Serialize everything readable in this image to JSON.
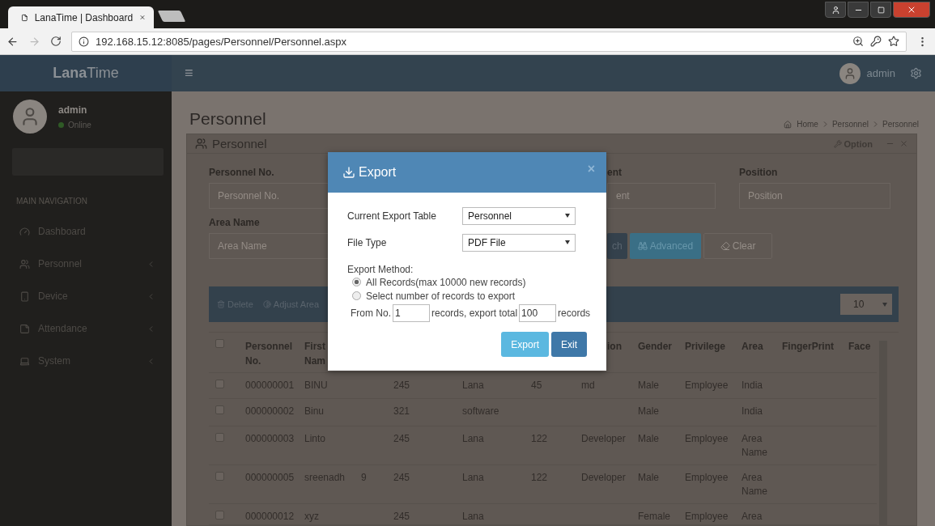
{
  "browser": {
    "tab_title": "LanaTime | Dashboard",
    "url": "192.168.15.12:8085/pages/Personnel/Personnel.aspx"
  },
  "app_header": {
    "logo": "**Lana**Time",
    "menu_icon": "≡",
    "user": "admin"
  },
  "sidebar": {
    "user": {
      "name": "admin",
      "status": "Online"
    },
    "nav_heading": "MAIN NAVIGATION",
    "items": [
      {
        "label": "Dashboard",
        "expandable": false
      },
      {
        "label": "Personnel",
        "expandable": true
      },
      {
        "label": "Device",
        "expandable": true
      },
      {
        "label": "Attendance",
        "expandable": true
      },
      {
        "label": "System",
        "expandable": true
      }
    ]
  },
  "page": {
    "title": "Personnel",
    "breadcrumb": [
      "Home",
      "Personnel",
      "Personnel"
    ]
  },
  "panel": {
    "title": "Personnel",
    "option": "Option"
  },
  "filters": [
    {
      "label": "Personnel No.",
      "placeholder": "Personnel No."
    },
    {
      "label": "ent",
      "placeholder": "ent"
    },
    {
      "label": "Position",
      "placeholder": "Position"
    },
    {
      "label": "Area Name",
      "placeholder": "Area Name"
    }
  ],
  "search_buttons": [
    {
      "label": "ch",
      "kind": "primary"
    },
    {
      "label": "Advanced",
      "kind": "info"
    },
    {
      "label": "Clear",
      "kind": "plain"
    }
  ],
  "toolbar": {
    "actions": [
      "Delete",
      "Adjust Area"
    ],
    "page_size": "10"
  },
  "table": {
    "header_checked": false,
    "columns": [
      "Personnel No.",
      "First Nam",
      null,
      null,
      null,
      null,
      "ion",
      "Gender",
      "Privilege",
      "Area",
      "FingerPrint",
      "Face"
    ],
    "rows": [
      {
        "checked": false,
        "cells": [
          "000000001",
          "BINU",
          null,
          "245",
          "Lana",
          "45",
          "md",
          "Male",
          "Employee",
          "India",
          null,
          null
        ]
      },
      {
        "checked": false,
        "cells": [
          "000000002",
          "Binu",
          null,
          "321",
          "software",
          null,
          null,
          "Male",
          null,
          "India",
          null,
          null
        ]
      },
      {
        "checked": false,
        "cells": [
          "000000003",
          "Linto",
          null,
          "245",
          "Lana",
          "122",
          "Developer",
          "Male",
          "Employee",
          "Area Name",
          null,
          null
        ]
      },
      {
        "checked": false,
        "cells": [
          "000000005",
          "sreenadh",
          "9",
          "245",
          "Lana",
          "122",
          "Developer",
          "Male",
          "Employee",
          "Area Name",
          null,
          null
        ]
      },
      {
        "checked": false,
        "cells": [
          "000000012",
          "xyz",
          null,
          "245",
          "Lana",
          null,
          null,
          "Female",
          "Employee",
          "Area",
          null,
          null
        ]
      }
    ]
  },
  "modal": {
    "title": "Export",
    "close": "×",
    "fields": [
      {
        "label": "Current Export Table",
        "value": "Personnel"
      },
      {
        "label": "File Type",
        "value": "PDF File"
      }
    ],
    "method_label": "Export Method:",
    "options": [
      {
        "label": "All Records(max 10000 new records)",
        "selected": true
      },
      {
        "label": "Select number of records to export",
        "selected": false
      }
    ],
    "range": {
      "from_label": "From No.",
      "from_value": "1",
      "middle": "records, export total",
      "total_value": "100",
      "end": "records"
    },
    "buttons": [
      {
        "label": "Export",
        "kind": "primary"
      },
      {
        "label": "Exit",
        "kind": "secondary"
      }
    ]
  }
}
